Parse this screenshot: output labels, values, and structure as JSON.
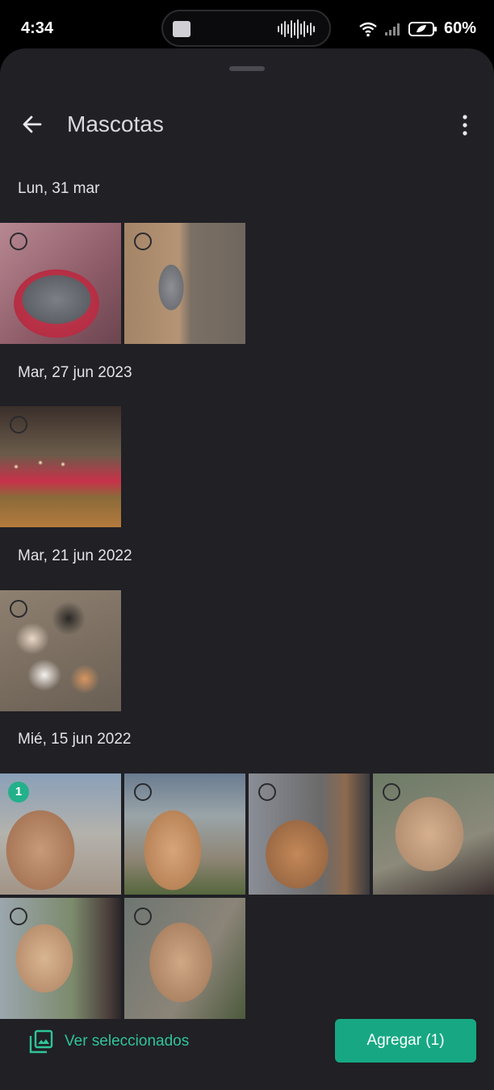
{
  "status_bar": {
    "time": "4:34",
    "battery": "60%"
  },
  "header": {
    "title": "Mascotas"
  },
  "sections": [
    {
      "date": "Lun, 31 mar",
      "photos": [
        {
          "selected": false,
          "subject": "kittens in red dotted bed"
        },
        {
          "selected": false,
          "subject": "grey and white kitten on wooden plank"
        }
      ]
    },
    {
      "date": "Mar, 27 jun 2023",
      "photos": [
        {
          "selected": false,
          "subject": "kittens in bed with glowing eyes"
        }
      ]
    },
    {
      "date": "Mar, 21 jun 2022",
      "photos": [
        {
          "selected": false,
          "subject": "group of kittens"
        }
      ]
    },
    {
      "date": "Mié, 15 jun 2022",
      "photos": [
        {
          "selected": true,
          "badge": "1",
          "subject": "orange long-haired cat close-up"
        },
        {
          "selected": false,
          "subject": "orange cat outdoors"
        },
        {
          "selected": false,
          "subject": "orange cat by window"
        },
        {
          "selected": false,
          "subject": "orange cat against window"
        },
        {
          "selected": false,
          "subject": "orange cat on window sill"
        },
        {
          "selected": false,
          "subject": "orange cat close-up"
        }
      ]
    }
  ],
  "bottom_bar": {
    "view_selected_label": "Ver seleccionados",
    "add_button_label": "Agregar (1)"
  },
  "colors": {
    "accent": "#17a883",
    "accent_text": "#2fc49a",
    "sheet_bg": "#202025"
  }
}
